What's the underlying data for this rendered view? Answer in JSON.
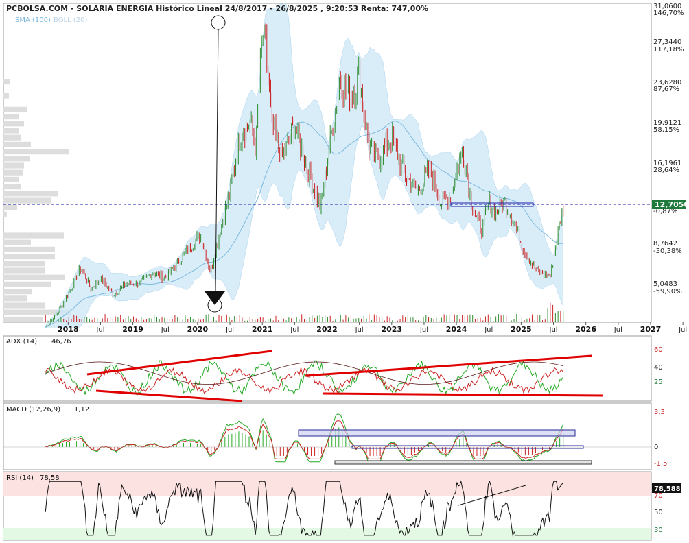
{
  "colors": {
    "up": "#2e8b2e",
    "down": "#cc2222",
    "band": "#cfe8f8",
    "sma": "#7ab8de",
    "price_line": "#1a1aa8",
    "price_box": "#1e7a3a",
    "adx_green": "#22aa22",
    "adx_red": "#cc2222",
    "macd": "#22aa22",
    "signal": "#cc2222",
    "trend": "#e00000",
    "rsi_high_zone": "#fde2e2",
    "rsi_low_zone": "#e3f9e3"
  },
  "chart": {
    "title": "PCBOLSA.COM - SOLARIA ENERGIA Histórico Lineal 24/8/2017 - 26/8/2025 , 9:20:53 Renta: 747,00%",
    "legend_sma": "SMA (100)",
    "legend_boll": "BOLL (20)",
    "current_price_label": "12,7050",
    "price_axis": [
      {
        "price": "31,0600",
        "pct": "146,70%",
        "pct_color": "#1e7a3a"
      },
      {
        "price": "27,3440",
        "pct": "117,18%",
        "pct_color": "#1e7a3a"
      },
      {
        "price": "23,6280",
        "pct": "87,67%",
        "pct_color": "#1e7a3a"
      },
      {
        "price": "19,9121",
        "pct": "58,15%",
        "pct_color": "#1e7a3a"
      },
      {
        "price": "16,1961",
        "pct": "28,64%",
        "pct_color": "#1e7a3a"
      },
      {
        "price": "",
        "pct": "-0,87%",
        "pct_color": "#cc2222"
      },
      {
        "price": "8,7642",
        "pct": "-30,38%",
        "pct_color": "#cc2222"
      },
      {
        "price": "5,0483",
        "pct": "-59,90%",
        "pct_color": "#cc2222"
      }
    ],
    "x_labels": [
      "2018",
      "Jul",
      "2019",
      "Jul",
      "2020",
      "Jul",
      "2021",
      "Jul",
      "2022",
      "Jul",
      "2023",
      "Jul",
      "2024",
      "Jul",
      "2025",
      "Jul",
      "2026",
      "Jul",
      "2027",
      "Jul"
    ]
  },
  "adx": {
    "label": "ADX (14)",
    "value": "46,76",
    "axis": [
      "60",
      "40",
      "25"
    ]
  },
  "macd": {
    "label": "MACD (12,26,9)",
    "value": "1,12",
    "axis": [
      {
        "text": "3,3",
        "color": "#cc2222"
      },
      {
        "text": "0",
        "color": "#222222"
      },
      {
        "text": "-1,5",
        "color": "#cc2222"
      }
    ]
  },
  "rsi": {
    "label": "RSI (14)",
    "value": "78,58",
    "axis": [
      {
        "text": "70",
        "color": "#cc2222"
      },
      {
        "text": "50",
        "color": "#222222"
      },
      {
        "text": "30",
        "color": "#1e7a3a"
      }
    ],
    "current_label": "78,588"
  },
  "chart_data": {
    "type": "line",
    "title": "PCBOLSA.COM - SOLARIA ENERGIA Histórico Lineal 24/8/2017 - 26/8/2025 , 9:20:53 Renta: 747,00%",
    "x_unit": "year",
    "ylim": [
      1.33,
      31.06
    ],
    "current_price": 12.705,
    "series": [
      {
        "name": "",
        "x": [
          2017.65,
          2017.8,
          2018.0,
          2018.2,
          2018.35,
          2018.5,
          2018.7,
          2018.9,
          2019.1,
          2019.3,
          2019.5,
          2019.7,
          2019.9,
          2020.05,
          2020.2,
          2020.35,
          2020.5,
          2020.65,
          2020.8,
          2020.9,
          2021.0,
          2021.05,
          2021.15,
          2021.3,
          2021.5,
          2021.7,
          2021.9,
          2022.05,
          2022.2,
          2022.35,
          2022.5,
          2022.65,
          2022.8,
          2023.0,
          2023.2,
          2023.4,
          2023.6,
          2023.75,
          2023.9,
          2024.1,
          2024.2,
          2024.3,
          2024.4,
          2024.5,
          2024.6,
          2024.75,
          2024.9,
          2025.05,
          2025.2,
          2025.3,
          2025.45,
          2025.55,
          2025.65
        ],
        "values": [
          1.5,
          2.5,
          4.5,
          7.0,
          5.0,
          6.0,
          4.5,
          5.5,
          5.5,
          6.5,
          6.0,
          7.5,
          9.0,
          10.0,
          6.5,
          10.5,
          14.0,
          19.0,
          20.5,
          18.0,
          28.5,
          27.0,
          20.0,
          17.0,
          20.0,
          16.0,
          12.5,
          18.5,
          24.5,
          22.5,
          24.5,
          18.0,
          17.0,
          19.0,
          15.5,
          14.0,
          16.0,
          13.0,
          13.5,
          18.0,
          14.0,
          11.5,
          10.5,
          13.0,
          12.0,
          13.0,
          11.0,
          8.5,
          7.0,
          6.5,
          6.2,
          9.5,
          12.7
        ]
      }
    ],
    "indicators": {
      "SMA (100)": "overlay",
      "BOLL (20)": "overlay",
      "ADX (14)": 46.76,
      "MACD (12,26,9)": 1.12,
      "RSI (14)": 78.58
    },
    "adx_ylim": [
      0,
      70
    ],
    "macd_ylim": [
      -1.5,
      3.3
    ],
    "rsi_ylim": [
      20,
      90
    ]
  }
}
